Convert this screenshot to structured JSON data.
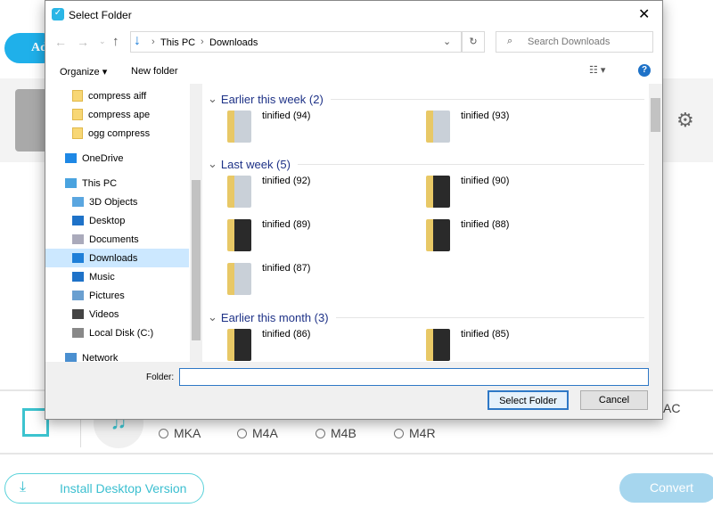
{
  "app": {
    "add_label": "Ad",
    "formats": [
      "MKA",
      "M4A",
      "M4B",
      "M4R"
    ],
    "partial_format": "AC",
    "install_label": "Install Desktop Version",
    "convert_label": "Convert",
    "accent": "#1fb0ea"
  },
  "dialog": {
    "title": "Select Folder",
    "breadcrumb": [
      "This PC",
      "Downloads"
    ],
    "search_placeholder": "Search Downloads",
    "organize_label": "Organize",
    "new_folder_label": "New folder",
    "nav": [
      {
        "label": "compress aiff",
        "icon": "folder-icon"
      },
      {
        "label": "compress ape",
        "icon": "folder-icon"
      },
      {
        "label": "ogg compress",
        "icon": "folder-icon"
      },
      {
        "label": "OneDrive",
        "icon": "cloud-icon"
      },
      {
        "label": "This PC",
        "icon": "computer-icon"
      },
      {
        "label": "3D Objects",
        "icon": "cube-icon"
      },
      {
        "label": "Desktop",
        "icon": "desktop-icon"
      },
      {
        "label": "Documents",
        "icon": "document-icon"
      },
      {
        "label": "Downloads",
        "icon": "download-icon",
        "selected": true
      },
      {
        "label": "Music",
        "icon": "music-icon"
      },
      {
        "label": "Pictures",
        "icon": "pictures-icon"
      },
      {
        "label": "Videos",
        "icon": "videos-icon"
      },
      {
        "label": "Local Disk (C:)",
        "icon": "disk-icon"
      },
      {
        "label": "Network",
        "icon": "network-icon"
      }
    ],
    "groups": [
      {
        "label": "Earlier this week (2)",
        "items": [
          "tinified (94)",
          "tinified (93)"
        ]
      },
      {
        "label": "Last week (5)",
        "items": [
          "tinified (92)",
          "tinified (90)",
          "tinified (89)",
          "tinified (88)",
          "tinified (87)"
        ]
      },
      {
        "label": "Earlier this month (3)",
        "items": [
          "tinified (86)",
          "tinified (85)"
        ]
      }
    ],
    "folder_label": "Folder:",
    "folder_value": "",
    "select_label": "Select Folder",
    "cancel_label": "Cancel"
  }
}
